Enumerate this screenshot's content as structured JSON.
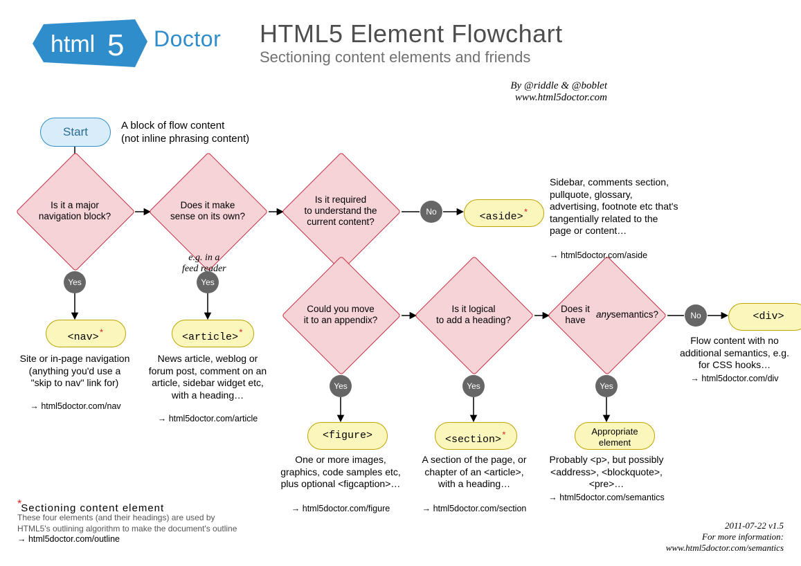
{
  "logo": {
    "html5": "html5",
    "doctor": "Doctor"
  },
  "header": {
    "title": "HTML5 Element Flowchart",
    "subtitle": "Sectioning content elements and friends",
    "byline1": "By @riddle & @boblet",
    "byline2": "www.html5doctor.com"
  },
  "start": {
    "label": "Start",
    "note": "A block of flow content\n(not inline phrasing content)"
  },
  "decisions": {
    "d1": "Is it a major\nnavigation block?",
    "d2": "Does it make\nsense on its own?",
    "d2_note": "e.g. in a\nfeed reader",
    "d3": "Is it required\nto understand the\ncurrent content?",
    "d4": "Could you move\nit to an appendix?",
    "d5": "Is it logical\nto add a heading?",
    "d6": "Does it have\nany semantics?"
  },
  "yn": {
    "yes": "Yes",
    "no": "No"
  },
  "results": {
    "nav": "<nav>",
    "article": "<article>",
    "aside": "<aside>",
    "figure": "<figure>",
    "section": "<section>",
    "appro": "Appropriate\nelement",
    "div": "<div>"
  },
  "descs": {
    "nav": "Site or in-page navigation (anything you'd use a \"skip to nav\" link for)",
    "article": "News article, weblog or forum post, comment on an article, sidebar widget etc, with a heading…",
    "aside": "Sidebar, comments section, pullquote, glossary, advertising, footnote etc that's tangentially related to the page or content…",
    "figure": "One or more images, graphics, code samples etc, plus optional <figcaption>…",
    "section": "A section of the page, or chapter of an <article>, with a heading…",
    "appro": "Probably <p>, but possibly <address>, <blockquote>, <pre>…",
    "div": "Flow content with no additional semantics, e.g. for CSS hooks…"
  },
  "links": {
    "nav": "→ html5doctor.com/nav",
    "article": "→ html5doctor.com/article",
    "aside": "→ html5doctor.com/aside",
    "figure": "→ html5doctor.com/figure",
    "section": "→ html5doctor.com/section",
    "appro": "→ html5doctor.com/semantics",
    "div": "→ html5doctor.com/div"
  },
  "footnote": {
    "title": "*Sectioning content element",
    "body": "These four elements (and their headings) are used by HTML5's outlining algorithm to make the document's outline",
    "link": "→ html5doctor.com/outline"
  },
  "version": {
    "date": "2011-07-22 v1.5",
    "more": "For more information:",
    "url": "www.html5doctor.com/semantics"
  }
}
